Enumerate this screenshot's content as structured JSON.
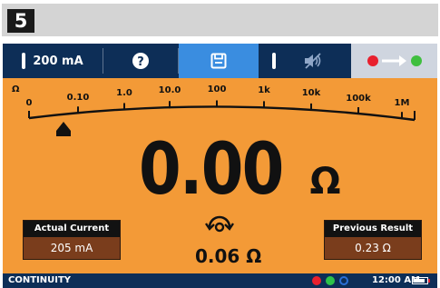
{
  "step": {
    "number": "5"
  },
  "toolbar": {
    "range_label": "200 mA",
    "help_icon": "question-circle-icon",
    "save_icon": "floppy-disk-icon",
    "mute_icon": "speaker-muted-icon",
    "lead_icon": "lead-null-arrow-icon"
  },
  "scale": {
    "unit_label": "Ω",
    "ticks": [
      "0",
      "0.10",
      "1.0",
      "10.0",
      "100",
      "1k",
      "10k",
      "100k",
      "1M"
    ]
  },
  "reading": {
    "value": "0.00",
    "unit": "Ω"
  },
  "actual_current": {
    "title": "Actual Current",
    "value": "205 mA"
  },
  "previous_result": {
    "title": "Previous Result",
    "value": "0.23 Ω"
  },
  "lead_offset": {
    "icon": "lead-offset-icon",
    "value": "0.06 Ω"
  },
  "status_bar": {
    "mode": "CONTINUITY",
    "time": "12:00 AM",
    "indicators": [
      "#e8202e",
      "#2ec24a",
      "#2a6fd6"
    ],
    "battery_level": 0.85
  },
  "colors": {
    "display_background": "#f39a37",
    "toolbar": "#0d2e57",
    "save_highlight": "#3a8de0",
    "panel_value": "#7a3d1c"
  }
}
